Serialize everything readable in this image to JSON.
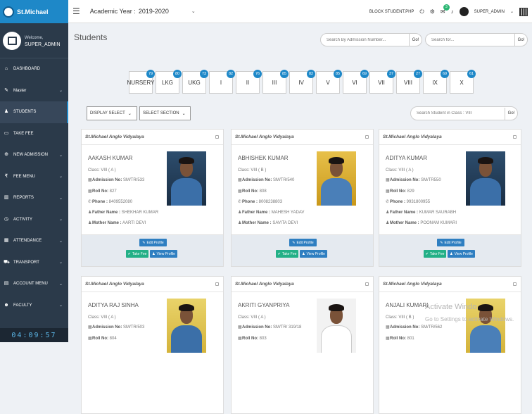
{
  "brand": {
    "name": "St.Michael"
  },
  "profile": {
    "welcome": "Welcome,",
    "username": "SUPER_ADMIN"
  },
  "sidebar": {
    "items": [
      {
        "label": "DASHBOARD",
        "icon": "home-icon",
        "chevron": false
      },
      {
        "label": "Master",
        "icon": "edit-icon",
        "chevron": true
      },
      {
        "label": "STUDENTS",
        "icon": "users-icon",
        "chevron": false,
        "active": true
      },
      {
        "label": "TAKE FEE",
        "icon": "money-icon",
        "chevron": false
      },
      {
        "label": "NEW ADMISSION",
        "icon": "plus-circle-icon",
        "chevron": true
      },
      {
        "label": "FEE MENU",
        "icon": "rupee-icon",
        "chevron": true
      },
      {
        "label": "REPORTS",
        "icon": "bar-chart-icon",
        "chevron": true
      },
      {
        "label": "ACTIVITY",
        "icon": "clock-icon",
        "chevron": true
      },
      {
        "label": "ATTENDANCE",
        "icon": "calendar-icon",
        "chevron": true
      },
      {
        "label": "TRANSPORT",
        "icon": "truck-icon",
        "chevron": true
      },
      {
        "label": "ACCOUNT MENU",
        "icon": "bank-icon",
        "chevron": true
      },
      {
        "label": "FACULTY",
        "icon": "user-icon",
        "chevron": true
      }
    ]
  },
  "clock": "04:09:57",
  "topbar": {
    "academic_label": "Academic Year :",
    "academic_year": "2019-2020",
    "block_label": "BLOCK STUDENT.PHP",
    "notif_count": "3",
    "user": "SUPER_ADMIN"
  },
  "page": {
    "title": "Students"
  },
  "search": {
    "admission_placeholder": "Search By Admission Number...",
    "admission_btn": "Go!",
    "name_placeholder": "Search for...",
    "name_btn": "Go!"
  },
  "classes": [
    {
      "label": "NURSERY",
      "count": "79"
    },
    {
      "label": "LKG",
      "count": "80"
    },
    {
      "label": "UKG",
      "count": "73"
    },
    {
      "label": "I",
      "count": "82"
    },
    {
      "label": "II",
      "count": "76"
    },
    {
      "label": "III",
      "count": "85"
    },
    {
      "label": "IV",
      "count": "82"
    },
    {
      "label": "V",
      "count": "85"
    },
    {
      "label": "VI",
      "count": "69"
    },
    {
      "label": "VII",
      "count": "37"
    },
    {
      "label": "VIII",
      "count": "27"
    },
    {
      "label": "IX",
      "count": "69"
    },
    {
      "label": "X",
      "count": "61"
    }
  ],
  "filters": {
    "display": "DISPLAY SELECT",
    "section": "SELECT SECTION",
    "class_search_placeholder": "Search Student in Class : VIII",
    "class_search_btn": "Go!"
  },
  "card_labels": {
    "school": "St.Michael Anglo Vidyalaya",
    "class": "Class:",
    "admission": "Admission No:",
    "roll": "Roll No:",
    "phone": "Phone :",
    "father": "Father Name :",
    "mother": "Mother Name :",
    "edit": "Edit Profile",
    "fee": "Take Fee",
    "view": "View Profile"
  },
  "students": [
    {
      "name": "AAKASH KUMAR",
      "class": "VIII ( A )",
      "admission": "SM/TR/533",
      "roll": "827",
      "phone": "8409552080",
      "father": "SHEKHAR KUMAR",
      "mother": "AARTI DEVI"
    },
    {
      "name": "ABHISHEK KUMAR",
      "class": "VIII ( B )",
      "admission": "SM/TR/540",
      "roll": "808",
      "phone": "8008238803",
      "father": "MAHESH YADAV",
      "mother": "SAVITA DEVI"
    },
    {
      "name": "ADITYA KUMAR",
      "class": "VIII ( A )",
      "admission": "SM/TR550",
      "roll": "829",
      "phone": "9931800955",
      "father": "KUMAR SAURABH",
      "mother": "POONAM KUMARI"
    },
    {
      "name": "ADITYA RAJ SINHA",
      "class": "VIII ( A )",
      "admission": "SM/TR/503",
      "roll": "804"
    },
    {
      "name": "AKRITI GYANPRIYA",
      "class": "VIII ( A )",
      "admission": "SM/TR/ 319/18",
      "roll": "803"
    },
    {
      "name": "ANJALI KUMARI",
      "class": "VIII ( B )",
      "admission": "SM/TR/562",
      "roll": "801"
    }
  ],
  "watermark": {
    "line1": "Activate Windo",
    "line2": "Go to Settings to activate Windows."
  }
}
